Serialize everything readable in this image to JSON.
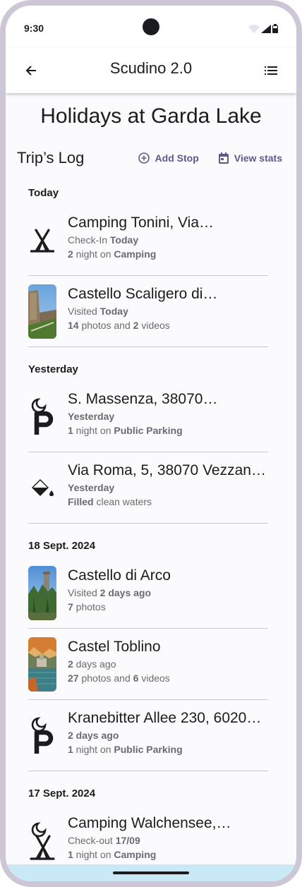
{
  "status_bar": {
    "time": "9:30"
  },
  "app_bar": {
    "title": "Scudino 2.0"
  },
  "page": {
    "title": "Holidays at Garda Lake"
  },
  "log": {
    "title": "Trip’s Log",
    "add_stop_label": "Add Stop",
    "view_stats_label": "View stats"
  },
  "sections": [
    {
      "header": "Today",
      "items": [
        {
          "icon": "tent-icon",
          "name": "Camping Tonini, Via…",
          "line1": [
            {
              "t": "Check-In "
            },
            {
              "t": "Today",
              "b": true
            }
          ],
          "line2": [
            {
              "t": "2",
              "b": true
            },
            {
              "t": " night on "
            },
            {
              "t": "Camping",
              "b": true
            }
          ]
        },
        {
          "icon": "photo-castle-scaligero",
          "name": "Castello Scaligero di…",
          "line1": [
            {
              "t": "Visited "
            },
            {
              "t": "Today",
              "b": true
            }
          ],
          "line2": [
            {
              "t": "14",
              "b": true
            },
            {
              "t": " photos and "
            },
            {
              "t": "2",
              "b": true
            },
            {
              "t": " videos"
            }
          ]
        }
      ]
    },
    {
      "header": "Yesterday",
      "items": [
        {
          "icon": "night-parking-icon",
          "name": "S. Massenza, 38070…",
          "line1": [
            {
              "t": "Yesterday",
              "b": true
            }
          ],
          "line2": [
            {
              "t": "1",
              "b": true
            },
            {
              "t": " night on "
            },
            {
              "t": "Public Parking",
              "b": true
            }
          ]
        },
        {
          "icon": "water-fill-icon",
          "name": "Via Roma, 5, 38070 Vezzan…",
          "line1": [
            {
              "t": "Yesterday",
              "b": true
            }
          ],
          "line2": [
            {
              "t": "Filled",
              "b": true
            },
            {
              "t": " clean waters"
            }
          ]
        }
      ]
    },
    {
      "header": "18 Sept. 2024",
      "items": [
        {
          "icon": "photo-castello-arco",
          "name": "Castello di Arco",
          "line1": [
            {
              "t": "Visited "
            },
            {
              "t": "2 days ago",
              "b": true
            }
          ],
          "line2": [
            {
              "t": "7",
              "b": true
            },
            {
              "t": " photos"
            }
          ]
        },
        {
          "icon": "photo-castel-toblino",
          "name": "Castel Toblino",
          "line1": [
            {
              "t": "2",
              "b": true
            },
            {
              "t": " days ago"
            }
          ],
          "line2": [
            {
              "t": "27",
              "b": true
            },
            {
              "t": " photos and "
            },
            {
              "t": "6",
              "b": true
            },
            {
              "t": " videos"
            }
          ]
        },
        {
          "icon": "night-parking-icon",
          "name": "Kranebitter Allee 230, 6020…",
          "line1": [
            {
              "t": "2 days ago",
              "b": true
            }
          ],
          "line2": [
            {
              "t": "1",
              "b": true
            },
            {
              "t": " night on "
            },
            {
              "t": "Public Parking",
              "b": true
            }
          ]
        }
      ]
    },
    {
      "header": "17 Sept. 2024",
      "items": [
        {
          "icon": "night-camping-icon",
          "name": "Camping Walchensee,…",
          "line1": [
            {
              "t": "Check-out "
            },
            {
              "t": "17/09",
              "b": true
            }
          ],
          "line2": [
            {
              "t": "1",
              "b": true
            },
            {
              "t": " night on "
            },
            {
              "t": "Camping",
              "b": true
            }
          ]
        }
      ]
    }
  ],
  "colors": {
    "accent": "#5c5a8c",
    "secondary_text": "#6b6a72",
    "divider": "#c9c6cf",
    "device_frame": "#cdc6d6",
    "nav_bar": "#c9e9f7"
  }
}
